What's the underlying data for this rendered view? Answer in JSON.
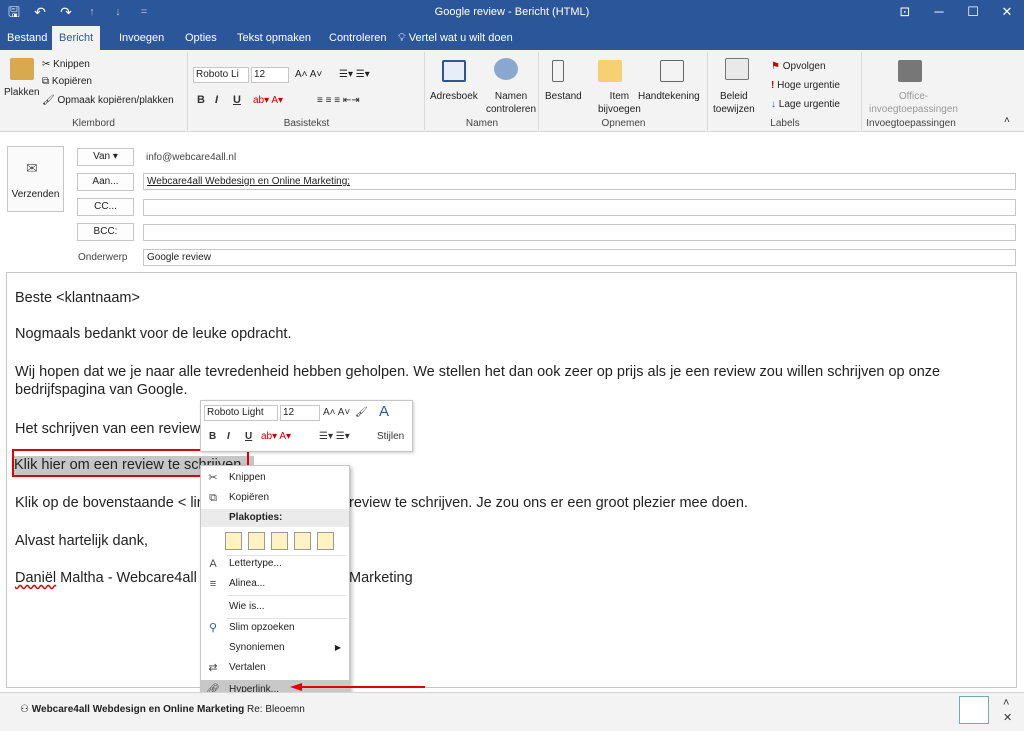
{
  "window": {
    "title": "Google review  -  Bericht (HTML)"
  },
  "quick_access": {
    "save": "🖫",
    "undo": "↶",
    "redo": "↷",
    "up": "↑",
    "down": "↓",
    "more": "="
  },
  "window_controls": {
    "ribbon_display": "⊡",
    "minimize": "─",
    "maximize": "☐",
    "close": "✕"
  },
  "menu": {
    "tabs": [
      "Bestand",
      "Bericht",
      "Invoegen",
      "Opties",
      "Tekst opmaken",
      "Controleren"
    ],
    "active": "Bericht",
    "tell_me": "Vertel wat u wilt doen"
  },
  "ribbon": {
    "klembord": {
      "label": "Klembord",
      "plakken": "Plakken",
      "knippen": "Knippen",
      "kopieren": "Kopiëren",
      "opmaak": "Opmaak kopiëren/plakken"
    },
    "basistekst": {
      "label": "Basistekst",
      "font": "Roboto Li",
      "size": "12",
      "bold": "B",
      "italic": "I",
      "underline": "U"
    },
    "namen": {
      "label": "Namen",
      "adresboek": "Adresboek",
      "namen_line1": "Namen",
      "namen_line2": "controleren"
    },
    "opnemen": {
      "label": "Opnemen",
      "bestand": "Bestand",
      "item_line1": "Item",
      "item_line2": "bijvoegen",
      "handtekening": "Handtekening"
    },
    "labels": {
      "label": "Labels",
      "beleid_line1": "Beleid",
      "beleid_line2": "toewijzen",
      "opvolgen": "Opvolgen",
      "hoge": "Hoge urgentie",
      "lage": "Lage urgentie"
    },
    "invoeg": {
      "label": "Invoegtoepassingen",
      "office_line1": "Office-",
      "office_line2": "invoegtoepassingen"
    }
  },
  "header": {
    "send": "Verzenden",
    "van": "Van ▾",
    "from_value": "info@webcare4all.nl",
    "aan": "Aan...",
    "aan_value": "Webcare4all Webdesign en Online Marketing;",
    "cc": "CC...",
    "bcc": "BCC:",
    "onderwerp_label": "Onderwerp",
    "onderwerp_value": "Google review"
  },
  "body": {
    "p1": "Beste <klantnaam>",
    "p2": "Nogmaals bedankt voor de leuke opdracht.",
    "p3": "Wij hopen dat we je naar alle tevredenheid hebben geholpen. We stellen het dan ook zeer op prijs als je een review zou willen schrijven op onze bedrijfspagina van Google.",
    "p4": "Het schrijven van een review",
    "p5": "Klik hier om een review te schrijven",
    "p6a": "Klik op de bovenstaande < lin",
    "p6b": "review te schrijven. Je zou ons er een groot plezier mee doen.",
    "p7": "Alvast hartelijk dank,",
    "p8a": "Daniël",
    "p8b": " Maltha - Webcare4all",
    "p8c": "Marketing"
  },
  "mini_toolbar": {
    "font": "Roboto Light",
    "size": "12",
    "bold": "B",
    "italic": "I",
    "underline": "U",
    "stijlen": "Stijlen"
  },
  "context_menu": {
    "knippen": "Knippen",
    "kopieren": "Kopiëren",
    "plakopties": "Plakopties:",
    "lettertype": "Lettertype...",
    "alinea": "Alinea...",
    "wie_is": "Wie is...",
    "slim": "Slim opzoeken",
    "synoniemen": "Synoniemen",
    "vertalen": "Vertalen",
    "hyperlink": "Hyperlink..."
  },
  "status": {
    "sender": "Webcare4all Webdesign en Online Marketing",
    "subject": "Re: Bleoemn"
  },
  "colors": {
    "titlebar": "#2b579a",
    "highlight_box": "#e00000"
  }
}
